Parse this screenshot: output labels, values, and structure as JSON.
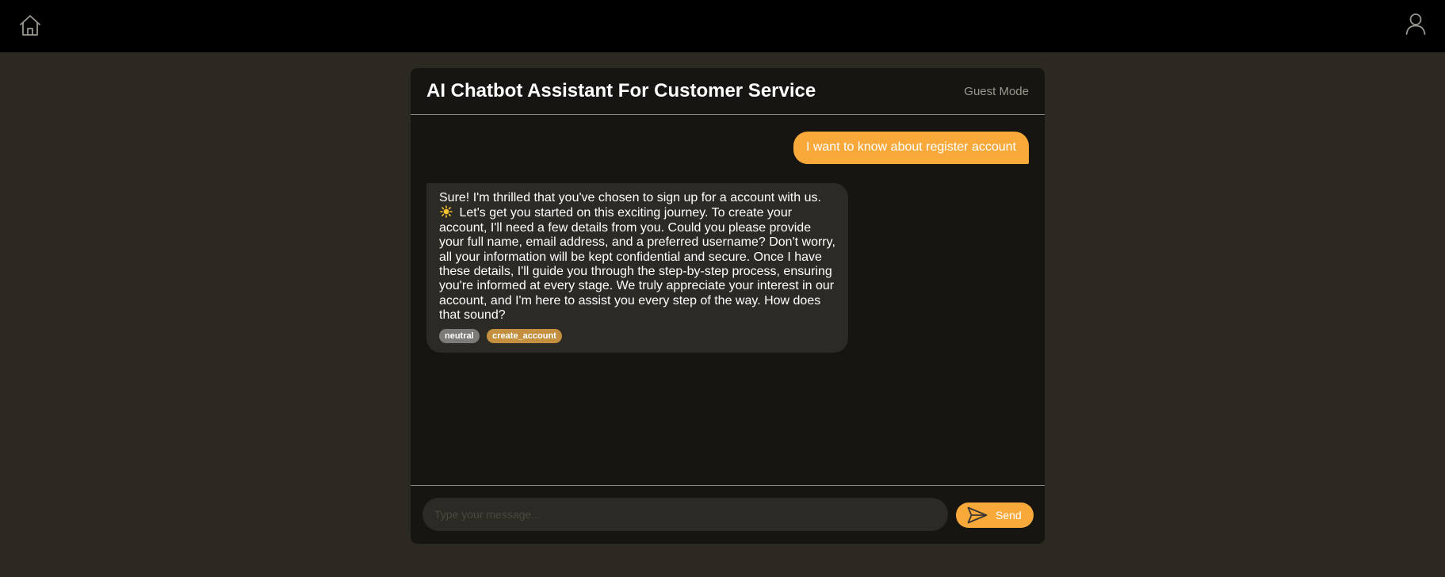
{
  "topbar": {
    "home_icon": "home-icon",
    "user_icon": "user-icon"
  },
  "chat": {
    "title": "AI Chatbot Assistant For Customer Service",
    "mode": "Guest Mode",
    "messages": [
      {
        "role": "user",
        "text": "I want to know about register account"
      },
      {
        "role": "bot",
        "text_before_icon": "Sure! I'm thrilled that you've chosen to sign up for a account with us.",
        "icon": "sun-icon",
        "text_after_icon": "Let's get you started on this exciting journey. To create your account, I'll need a few details from you. Could you please provide your full name, email address, and a preferred username? Don't worry, all your information will be kept confidential and secure. Once I have these details, I'll guide you through the step-by-step process, ensuring you're informed at every stage. We truly appreciate your interest in our account, and I'm here to assist you every step of the way. How does that sound?",
        "sentiment": "neutral",
        "intent": "create_account"
      }
    ],
    "input": {
      "placeholder": "Type your message...",
      "value": ""
    },
    "send_label": "Send"
  },
  "colors": {
    "accent": "#f9a93a",
    "background": "#2c2922",
    "panel": "#171511",
    "bot_bubble": "#2c2a25",
    "topbar": "#000000",
    "tag_neutral": "#7d7b77",
    "tag_intent": "#c48f3e"
  }
}
